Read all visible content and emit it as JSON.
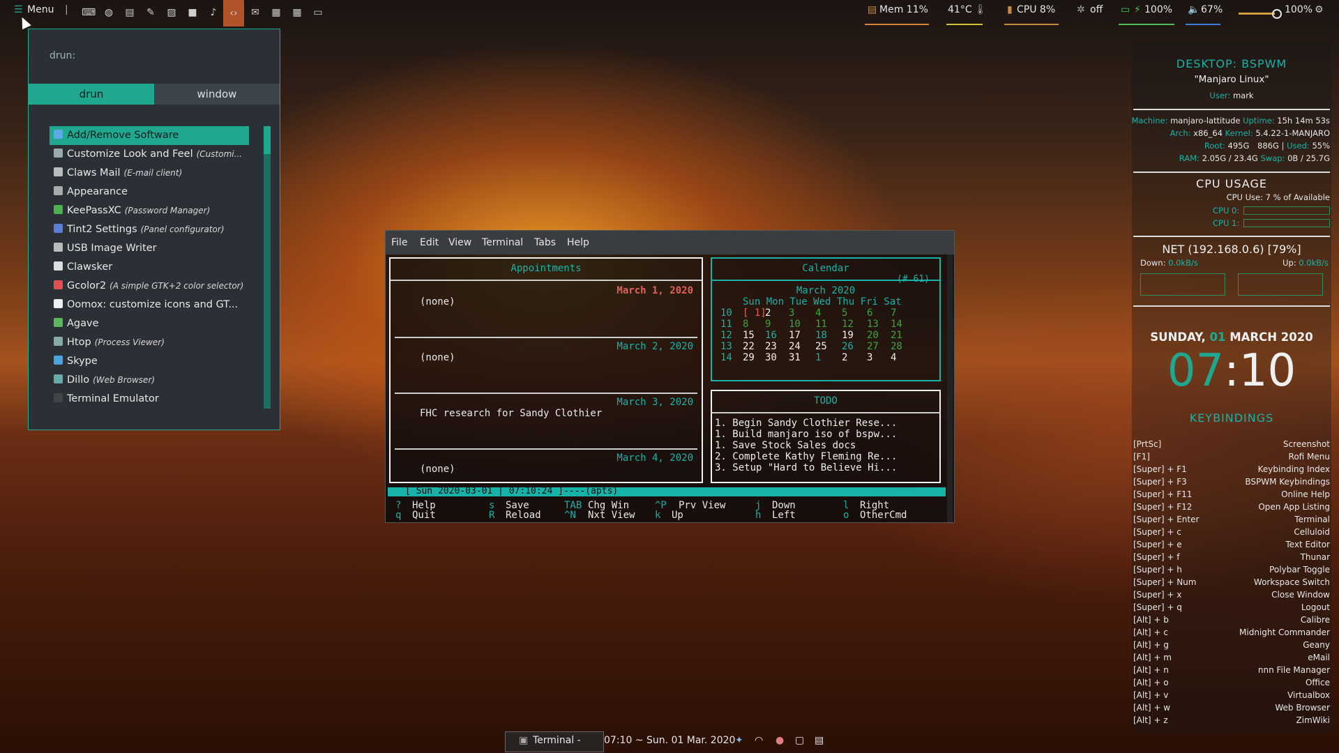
{
  "topbar": {
    "menu_label": "Menu",
    "menu_icon": "hamburger-icon",
    "launchers": [
      "keyboard-icon",
      "globe-icon",
      "file-icon",
      "edit-icon",
      "image-icon",
      "video-icon",
      "microphone-icon",
      "code-icon",
      "mail-icon",
      "printer-icon",
      "grid-icon",
      "window-icon"
    ],
    "mem": "Mem 11%",
    "temp": "41°C",
    "cpu": "CPU 8%",
    "fan": "off",
    "battery": "100%",
    "volume": "67%",
    "brightness": "100%",
    "colors": {
      "mem": "#d08a3a",
      "temp": "#d8c13a",
      "cpu": "#c58a3c",
      "battery": "#4bbf5a",
      "volume": "#3d7fd8",
      "accent": "#1fa88f"
    }
  },
  "rofi": {
    "prompt": "drun:",
    "tabs": [
      "drun",
      "window"
    ],
    "apps": [
      {
        "name": "Add/Remove Software",
        "desc": "",
        "icon": "package-icon",
        "color": "#5fa8e8"
      },
      {
        "name": "Customize Look and Feel",
        "desc": "(Customi...",
        "icon": "settings-icon",
        "color": "#9aa"
      },
      {
        "name": "Claws Mail",
        "desc": "(E-mail client)",
        "icon": "mail-icon",
        "color": "#bbb"
      },
      {
        "name": "Appearance",
        "desc": "",
        "icon": "appearance-icon",
        "color": "#aaa"
      },
      {
        "name": "KeePassXC",
        "desc": "(Password Manager)",
        "icon": "key-icon",
        "color": "#4caf50"
      },
      {
        "name": "Tint2 Settings",
        "desc": "(Panel configurator)",
        "icon": "panel-icon",
        "color": "#5a7ed8"
      },
      {
        "name": "USB Image Writer",
        "desc": "",
        "icon": "usb-icon",
        "color": "#bbb"
      },
      {
        "name": "Clawsker",
        "desc": "",
        "icon": "claws-icon",
        "color": "#ddd"
      },
      {
        "name": "Gcolor2",
        "desc": "(A simple GTK+2 color selector)",
        "icon": "color-picker-icon",
        "color": "#e05050"
      },
      {
        "name": "Oomox: customize icons and GT...",
        "desc": "",
        "icon": "palette-icon",
        "color": "#f0f0f0"
      },
      {
        "name": "Agave",
        "desc": "",
        "icon": "agave-icon",
        "color": "#5cb85c"
      },
      {
        "name": "Htop",
        "desc": "(Process Viewer)",
        "icon": "htop-icon",
        "color": "#8aa"
      },
      {
        "name": "Skype",
        "desc": "",
        "icon": "skype-icon",
        "color": "#4aa3e0"
      },
      {
        "name": "Dillo",
        "desc": "(Web Browser)",
        "icon": "browser-icon",
        "color": "#6aa"
      },
      {
        "name": "Terminal Emulator",
        "desc": "",
        "icon": "terminal-icon",
        "color": "#444"
      }
    ]
  },
  "terminal": {
    "menu": [
      "File",
      "Edit",
      "View",
      "Terminal",
      "Tabs",
      "Help"
    ],
    "appointments_title": "Appointments",
    "appointments": [
      {
        "date": "March  1, 2020",
        "text": "(none)"
      },
      {
        "date": "March  2, 2020",
        "text": "(none)"
      },
      {
        "date": "March  3, 2020",
        "text": "FHC research for Sandy Clothier"
      },
      {
        "date": "March  4, 2020",
        "text": "(none)"
      }
    ],
    "calendar_title": "Calendar",
    "calendar_week_tag": "(# 61)",
    "calendar_month": "March 2020",
    "calendar_header": "Sun Mon Tue Wed Thu Fri Sat",
    "calendar_weeks": [
      {
        "wk": "10",
        "days": [
          "[ 1]",
          "2",
          "3",
          "4",
          "5",
          "6",
          "7"
        ]
      },
      {
        "wk": "11",
        "days": [
          "8",
          "9",
          "10",
          "11",
          "12",
          "13",
          "14"
        ]
      },
      {
        "wk": "12",
        "days": [
          "15",
          "16",
          "17",
          "18",
          "19",
          "20",
          "21"
        ]
      },
      {
        "wk": "13",
        "days": [
          "22",
          "23",
          "24",
          "25",
          "26",
          "27",
          "28"
        ]
      },
      {
        "wk": "14",
        "days": [
          "29",
          "30",
          "31",
          "1",
          "2",
          "3",
          "4"
        ]
      }
    ],
    "todo_title": "TODO",
    "todo": [
      "1. Begin Sandy Clothier Rese...",
      "1. Build manjaro iso of bspw...",
      "1. Save Stock Sales docs",
      "2. Complete Kathy Fleming Re...",
      "3. Setup \"Hard to Believe Hi..."
    ],
    "status": "[ Sun 2020-03-01 | 07:10:24 ]----(apts)",
    "help_row1": [
      [
        "?",
        "Help"
      ],
      [
        "s",
        "Save"
      ],
      [
        "TAB",
        "Chg Win"
      ],
      [
        "^P",
        "Prv View"
      ],
      [
        "j",
        "Down"
      ],
      [
        "l",
        "Right"
      ]
    ],
    "help_row2": [
      [
        "q",
        "Quit"
      ],
      [
        "R",
        "Reload"
      ],
      [
        "^N",
        "Nxt View"
      ],
      [
        "k",
        "Up"
      ],
      [
        "h",
        "Left"
      ],
      [
        "o",
        "OtherCmd"
      ]
    ]
  },
  "conky": {
    "desktop": "DESKTOP: BSPWM",
    "distro": "\"Manjaro Linux\"",
    "user_label": "User:",
    "user": "mark",
    "machine_label": "Machine:",
    "machine": "manjaro-lattitude",
    "uptime_label": "Uptime:",
    "uptime": "15h 14m 53s",
    "arch_label": "Arch:",
    "arch": "x86_64",
    "kernel_label": "Kernel:",
    "kernel": "5.4.22-1-MANJARO",
    "root_label": "Root:",
    "root": "495G",
    "root_total": "886G",
    "used_label": "Used:",
    "used": "55%",
    "ram_label": "RAM:",
    "ram": "2.05G / 23.4G",
    "swap_label": "Swap:",
    "swap": "0B / 25.7G",
    "cpu_title": "CPU USAGE",
    "cpu_use": "CPU Use: 7 % of Available",
    "cpu0": "CPU 0:",
    "cpu1": "CPU 1:",
    "net_title": "NET (192.168.0.6) [79%]",
    "down_label": "Down:",
    "down": "0.0kB/s",
    "up_label": "Up:",
    "up": "0.0kB/s",
    "date_day": "SUNDAY,",
    "date_num": "01",
    "date_rest": "MARCH 2020",
    "clock_h": "07",
    "clock_m": ":10",
    "kb_title": "KEYBINDINGS",
    "keybindings": [
      [
        "[PrtSc]",
        "Screenshot"
      ],
      [
        "[F1]",
        "Rofi Menu"
      ],
      [
        "[Super] + F1",
        "Keybinding Index"
      ],
      [
        "[Super] + F3",
        "BSPWM Keybindings"
      ],
      [
        "[Super] + F11",
        "Online Help"
      ],
      [
        "[Super] + F12",
        "Open App Listing"
      ],
      [
        "[Super] + Enter",
        "Terminal"
      ],
      [
        "[Super] + c",
        "Celluloid"
      ],
      [
        "[Super] + e",
        "Text Editor"
      ],
      [
        "[Super] + f",
        "Thunar"
      ],
      [
        "[Super] + h",
        "Polybar Toggle"
      ],
      [
        "[Super] + Num",
        "Workspace Switch"
      ],
      [
        "[Super] + x",
        "Close Window"
      ],
      [
        "[Super] + q",
        "Logout"
      ],
      [
        "[Alt] + b",
        "Calibre"
      ],
      [
        "[Alt] + c",
        "Midnight Commander"
      ],
      [
        "[Alt] + g",
        "Geany"
      ],
      [
        "[Alt] + m",
        "eMail"
      ],
      [
        "[Alt] + n",
        "nnn File Manager"
      ],
      [
        "[Alt] + o",
        "Office"
      ],
      [
        "[Alt] + v",
        "Virtualbox"
      ],
      [
        "[Alt] + w",
        "Web Browser"
      ],
      [
        "[Alt] + z",
        "ZimWiki"
      ]
    ]
  },
  "bottombar": {
    "task": "Terminal -",
    "clock": "07:10 ~ Sun. 01 Mar. 2020",
    "tray": [
      "dropbox-icon",
      "wifi-icon",
      "color-icon",
      "display-icon",
      "clipboard-icon"
    ]
  }
}
